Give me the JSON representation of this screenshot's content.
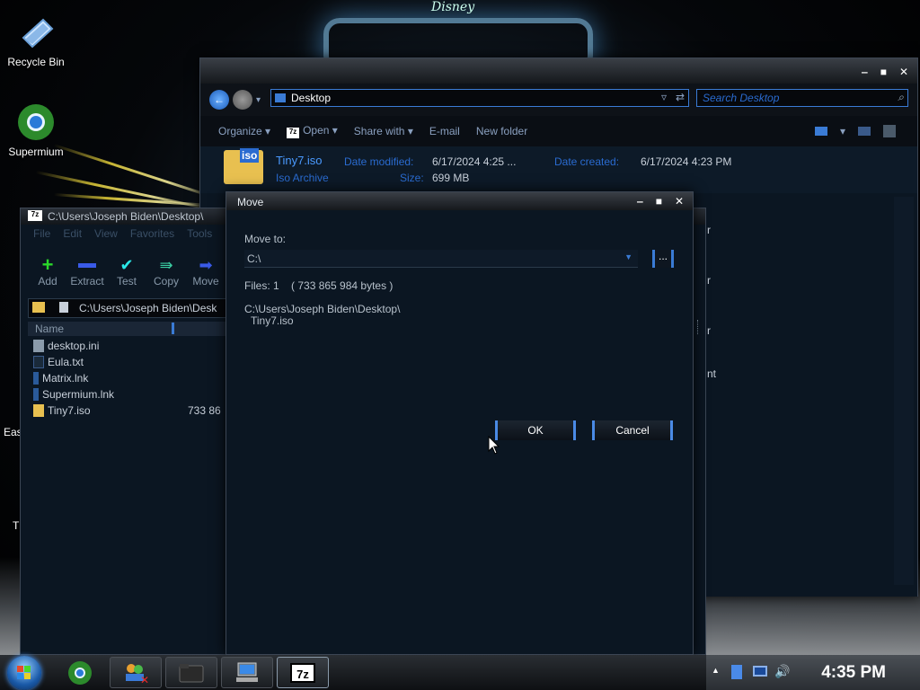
{
  "desktop": {
    "icons": [
      {
        "label": "Recycle Bin"
      },
      {
        "label": "Supermium"
      }
    ],
    "wallpaper_text": "Disney",
    "partial_labels": [
      "Eas",
      "T"
    ]
  },
  "explorer": {
    "address": "Desktop",
    "search_placeholder": "Search Desktop",
    "toolbar": {
      "organize": "Organize",
      "open": "Open",
      "share_with": "Share with",
      "email": "E-mail",
      "new_folder": "New folder"
    },
    "details": {
      "filename": "Tiny7.iso",
      "type": "Iso Archive",
      "date_modified_label": "Date modified:",
      "date_modified": "6/17/2024 4:25 ...",
      "date_created_label": "Date created:",
      "date_created": "6/17/2024 4:23 PM",
      "size_label": "Size:",
      "size": "699 MB"
    },
    "partial_right": [
      "r",
      "r",
      "r",
      "nt"
    ]
  },
  "sevenzip": {
    "title": "C:\\Users\\Joseph Biden\\Desktop\\",
    "menu": [
      "File",
      "Edit",
      "View",
      "Favorites",
      "Tools"
    ],
    "tools": [
      {
        "label": "Add",
        "icon": "plus-icon"
      },
      {
        "label": "Extract",
        "icon": "minus-icon"
      },
      {
        "label": "Test",
        "icon": "check-icon"
      },
      {
        "label": "Copy",
        "icon": "copy-arrow-icon"
      },
      {
        "label": "Move",
        "icon": "move-arrow-icon"
      }
    ],
    "path": "C:\\Users\\Joseph Biden\\Desk",
    "column_name": "Name",
    "files": [
      {
        "name": "desktop.ini",
        "size": ""
      },
      {
        "name": "Eula.txt",
        "size": ""
      },
      {
        "name": "Matrix.lnk",
        "size": ""
      },
      {
        "name": "Supermium.lnk",
        "size": ""
      },
      {
        "name": "Tiny7.iso",
        "size": "733 86"
      }
    ]
  },
  "move_dialog": {
    "title": "Move",
    "move_to_label": "Move to:",
    "destination": "C:\\",
    "browse_label": "...",
    "files_info": "Files: 1    ( 733 865 984 bytes )",
    "source_line1": "C:\\Users\\Joseph Biden\\Desktop\\",
    "source_line2": "Tiny7.iso",
    "ok_label": "OK",
    "cancel_label": "Cancel"
  },
  "taskbar": {
    "items": [
      "supermium-icon",
      "network-people-icon",
      "folder-icon",
      "computer-icon",
      "sevenzip-icon"
    ],
    "clock": "4:35 PM",
    "sevenzip_label": "7z"
  },
  "colors": {
    "accent": "#3a7bd5",
    "window_bg": "#0b1622",
    "link_blue": "#4a9aff"
  }
}
